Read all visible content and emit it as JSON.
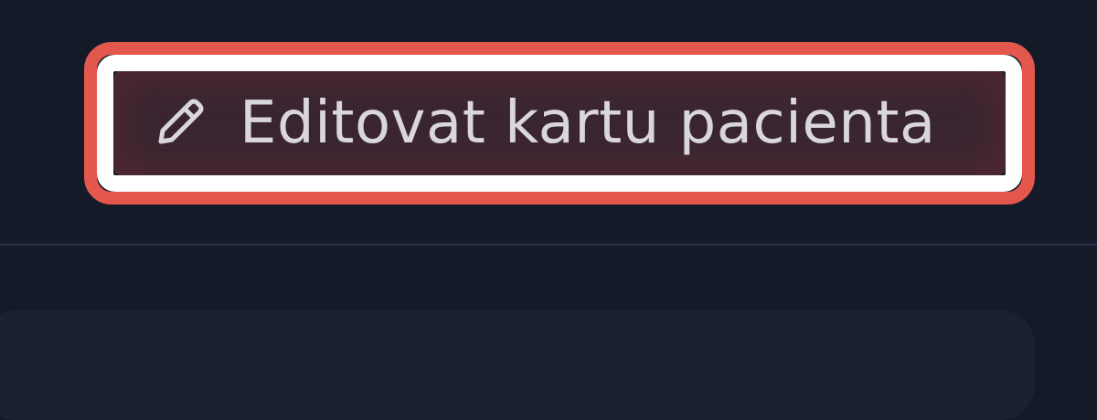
{
  "toolbar": {
    "edit_button_label": "Editovat kartu pacienta",
    "edit_button_icon": "pencil-icon"
  },
  "colors": {
    "page_background": "#141a28",
    "highlight": "#e4574c",
    "button_background": "#3a2630",
    "button_text": "#d9d6dc"
  }
}
